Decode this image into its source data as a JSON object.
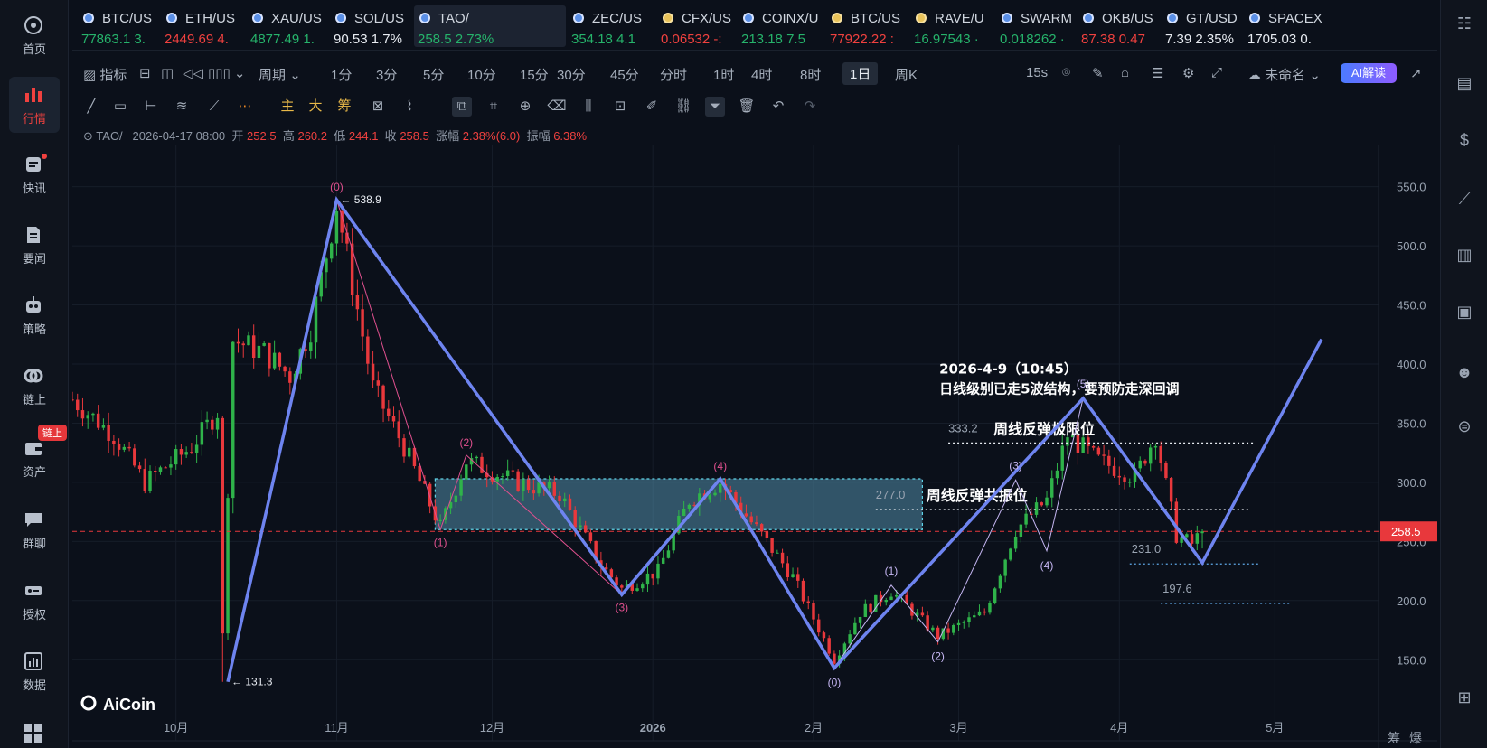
{
  "sidebar": {
    "items": [
      {
        "label": "首页",
        "icon": "home-logo-icon"
      },
      {
        "label": "行情",
        "icon": "bar-chart-icon"
      },
      {
        "label": "快讯",
        "icon": "news-flash-icon"
      },
      {
        "label": "要闻",
        "icon": "document-icon"
      },
      {
        "label": "策略",
        "icon": "robot-icon"
      },
      {
        "label": "链上",
        "icon": "chain-icon"
      },
      {
        "label": "资产",
        "icon": "wallet-icon"
      },
      {
        "label": "群聊",
        "icon": "chat-icon"
      },
      {
        "label": "授权",
        "icon": "key-icon"
      },
      {
        "label": "数据",
        "icon": "data-icon"
      }
    ],
    "badge": "链上"
  },
  "tickers": [
    {
      "symbol": "BTC/US",
      "value": "77863.1",
      "change": "3.",
      "dir": "up"
    },
    {
      "symbol": "ETH/US",
      "value": "2449.69",
      "change": "4.",
      "dir": "down"
    },
    {
      "symbol": "XAU/US",
      "value": "4877.49",
      "change": "1.",
      "dir": "up"
    },
    {
      "symbol": "SOL/US",
      "value": "90.53",
      "change": "1.7%",
      "dir": "neutral"
    },
    {
      "symbol": "TAO/",
      "value": "258.5",
      "change": "2.73%",
      "dir": "up"
    },
    {
      "symbol": "ZEC/US",
      "value": "354.18",
      "change": "4.1",
      "dir": "up"
    },
    {
      "symbol": "CFX/US",
      "value": "0.06532",
      "change": "-:",
      "dir": "down"
    },
    {
      "symbol": "COINX/U",
      "value": "213.18",
      "change": "7.5",
      "dir": "up"
    },
    {
      "symbol": "BTC/US",
      "value": "77922.22",
      "change": ":",
      "dir": "down"
    },
    {
      "symbol": "RAVE/U",
      "value": "16.97543",
      "change": "·",
      "dir": "up"
    },
    {
      "symbol": "SWARM",
      "value": "0.018262",
      "change": "·",
      "dir": "up"
    },
    {
      "symbol": "OKB/US",
      "value": "87.38",
      "change": "0.47",
      "dir": "down"
    },
    {
      "symbol": "GT/USD",
      "value": "7.39",
      "change": "2.35%",
      "dir": "neutral"
    },
    {
      "symbol": "SPACEX",
      "value": "1705.03",
      "change": "0.",
      "dir": "neutral"
    }
  ],
  "toolbar": {
    "indicator": "指标",
    "period": "周期",
    "intervals": [
      "1分",
      "3分",
      "5分",
      "10分",
      "15分",
      "30分",
      "45分",
      "分时",
      "1时",
      "4时",
      "8时",
      "1日",
      "周K"
    ],
    "active_interval": "1日",
    "refresh": "15s",
    "layout_name": "未命名",
    "ai_button": "AI解读"
  },
  "drawing_tools": [
    "主",
    "大",
    "筹"
  ],
  "info": {
    "symbol": "TAO/",
    "datetime": "2026-04-17 08:00",
    "open_label": "开",
    "open": "252.5",
    "high_label": "高",
    "high": "260.2",
    "low_label": "低",
    "low": "244.1",
    "close_label": "收",
    "close": "258.5",
    "change_label": "涨幅",
    "change": "2.38%(6.0)",
    "amp_label": "振幅",
    "amp": "6.38%"
  },
  "chart_data": {
    "type": "candlestick",
    "y_ticks": [
      150.0,
      200.0,
      250.0,
      300.0,
      350.0,
      400.0,
      450.0,
      500.0,
      550.0
    ],
    "y_tick_labels": [
      "150.0",
      "200.0",
      "250.0",
      "300.0",
      "350.0",
      "400.0",
      "450.0",
      "500.0",
      "550.0"
    ],
    "ylim": [
      112,
      578
    ],
    "x_ticks": [
      "10月",
      "11月",
      "12月",
      "2026",
      "2月",
      "3月",
      "4月",
      "5月"
    ],
    "x_tick_dates": [
      "2025-10-01",
      "2025-11-01",
      "2025-12-01",
      "2026-01-01",
      "2026-02-01",
      "2026-03-01",
      "2026-04-01",
      "2026-05-01"
    ],
    "xlim": [
      "2025-09-11",
      "2026-05-21"
    ],
    "current_price": 258.5,
    "current_price_label": "258.5",
    "extremes": [
      {
        "date": "2025-11-01",
        "price": 538.9,
        "label": "538.9"
      },
      {
        "date": "2025-10-11",
        "price": 131.3,
        "label": "131.3"
      }
    ],
    "wave_main": [
      {
        "date": "2025-10-11",
        "price": 131.3
      },
      {
        "date": "2025-11-01",
        "price": 538.9
      },
      {
        "date": "2025-12-26",
        "price": 205
      },
      {
        "date": "2026-01-14",
        "price": 303
      },
      {
        "date": "2026-02-05",
        "price": 143
      },
      {
        "date": "2026-03-25",
        "price": 371
      },
      {
        "date": "2026-04-17",
        "price": 232
      },
      {
        "date": "2026-05-10",
        "price": 421
      }
    ],
    "wave_sub_down": [
      {
        "date": "2025-11-01",
        "price": 538.9,
        "label": "(0)"
      },
      {
        "date": "2025-11-21",
        "price": 260,
        "label": "(1)"
      },
      {
        "date": "2025-11-26",
        "price": 323,
        "label": "(2)"
      },
      {
        "date": "2025-12-26",
        "price": 205,
        "label": "(3)"
      },
      {
        "date": "2026-01-14",
        "price": 303,
        "label": "(4)"
      }
    ],
    "wave_sub_up": [
      {
        "date": "2026-02-05",
        "price": 143,
        "label": "(0)"
      },
      {
        "date": "2026-02-16",
        "price": 213,
        "label": "(1)"
      },
      {
        "date": "2026-02-25",
        "price": 165,
        "label": "(2)"
      },
      {
        "date": "2026-03-12",
        "price": 302,
        "label": "(3)"
      },
      {
        "date": "2026-03-18",
        "price": 242,
        "label": "(4)"
      },
      {
        "date": "2026-03-25",
        "price": 371,
        "label": "(5)"
      }
    ],
    "zone": {
      "date_start": "2025-11-20",
      "date_end": "2026-02-22",
      "top": 303,
      "bottom": 260
    },
    "levels": [
      {
        "price": 333.2,
        "label": "333.2",
        "text": "周线反弹极限位",
        "date_start": "2026-02-27",
        "date_end": "2026-04-27"
      },
      {
        "price": 277.0,
        "label": "277.0",
        "text": "周线反弹共振位",
        "date_start": "2026-02-13",
        "date_end": "2026-04-26"
      },
      {
        "price": 231.0,
        "label": "231.0",
        "date_start": "2026-04-03",
        "date_end": "2026-04-28"
      },
      {
        "price": 197.6,
        "label": "197.6",
        "date_start": "2026-04-09",
        "date_end": "2026-05-04"
      }
    ],
    "annotation": {
      "line1": "2026-4-9（10:45）",
      "line2": "日线级别已走5波结构，要预防走深回调"
    },
    "watermark": "AiCoin",
    "bottom_right": [
      "筹",
      "爆"
    ]
  }
}
